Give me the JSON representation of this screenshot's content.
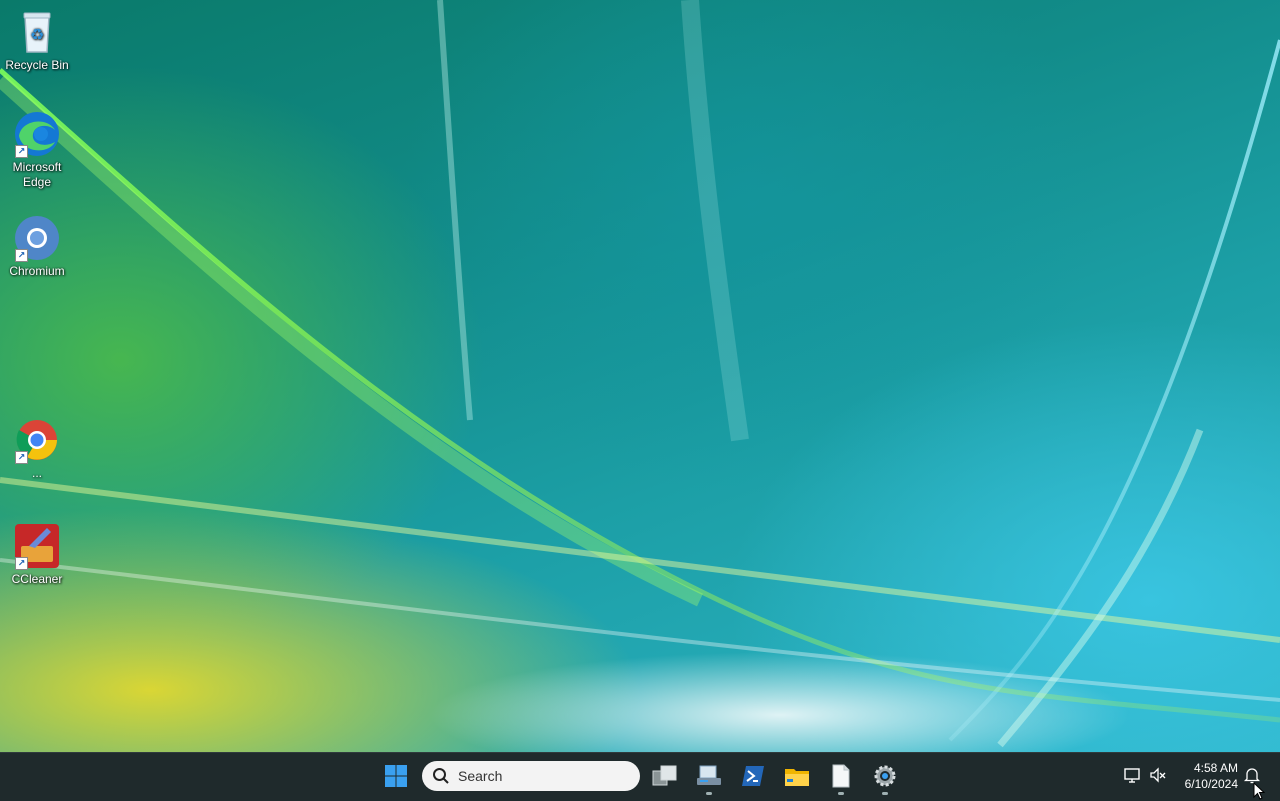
{
  "desktop": {
    "icons": [
      {
        "label": "Recycle Bin",
        "icon": "recycle-bin-icon"
      },
      {
        "label": "Microsoft Edge",
        "icon": "edge-icon"
      },
      {
        "label": "Chromium",
        "icon": "chromium-icon"
      },
      {
        "label": "...",
        "icon": "chrome-icon"
      },
      {
        "label": "CCleaner",
        "icon": "ccleaner-icon"
      }
    ]
  },
  "taskbar": {
    "search_placeholder": "Search",
    "apps": [
      {
        "icon": "start-icon"
      },
      {
        "icon": "task-view-icon"
      },
      {
        "icon": "network-drive-icon",
        "running": true
      },
      {
        "icon": "powershell-icon"
      },
      {
        "icon": "file-explorer-icon"
      },
      {
        "icon": "notepad-icon",
        "running": true
      },
      {
        "icon": "settings-gear-icon",
        "running": true
      }
    ],
    "tray": {
      "time": "4:58 AM",
      "date": "6/10/2024",
      "icons": [
        "display-icon",
        "volume-muted-icon",
        "notification-bell-icon"
      ]
    }
  },
  "colors": {
    "taskbar_bg": "#1f2a2c",
    "windows_blue": "#3aa0f0"
  }
}
